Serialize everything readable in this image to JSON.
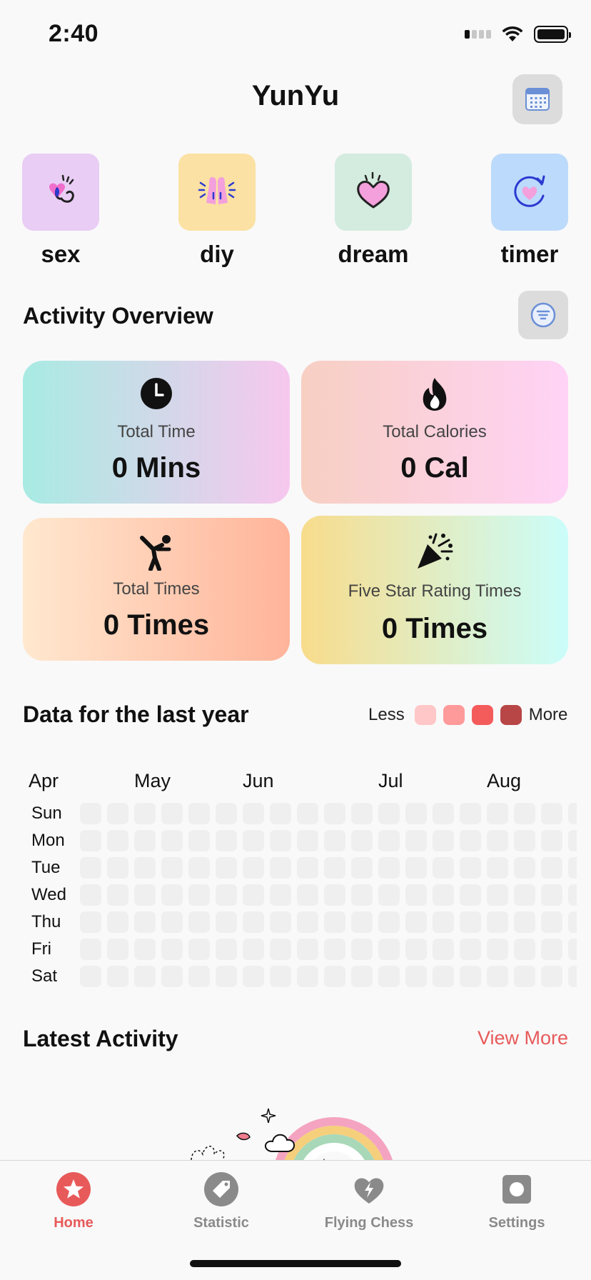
{
  "status_bar": {
    "time": "2:40"
  },
  "header": {
    "title": "YunYu",
    "calendar_icon": "calendar-icon"
  },
  "quick_actions": [
    {
      "label": "sex",
      "icon": "hand-heart-icon",
      "color": "#e9cdf5"
    },
    {
      "label": "diy",
      "icon": "praying-hands-icon",
      "color": "#fbe1a3"
    },
    {
      "label": "dream",
      "icon": "heart-icon",
      "color": "#d4ebdf"
    },
    {
      "label": "timer",
      "icon": "timer-heart-icon",
      "color": "#bcdafb"
    }
  ],
  "overview": {
    "title": "Activity Overview",
    "filter_icon": "filter-icon",
    "cards": [
      {
        "label": "Total Time",
        "value": "0 Mins",
        "icon": "clock-icon"
      },
      {
        "label": "Total Calories",
        "value": "0 Cal",
        "icon": "flame-icon"
      },
      {
        "label": "Total Times",
        "value": "0 Times",
        "icon": "exercise-icon"
      },
      {
        "label": "Five Star Rating Times",
        "value": "0 Times",
        "icon": "party-popper-icon"
      }
    ]
  },
  "heatmap": {
    "title": "Data for the last year",
    "legend_less": "Less",
    "legend_more": "More",
    "legend_colors": [
      "#ffc7c7",
      "#ff9a9a",
      "#f45c5c",
      "#b84646"
    ],
    "months": [
      "Apr",
      "May",
      "Jun",
      "Jul",
      "Aug"
    ],
    "days": [
      "Sun",
      "Mon",
      "Tue",
      "Wed",
      "Thu",
      "Fri",
      "Sat"
    ],
    "empty_color": "#efefef"
  },
  "latest": {
    "title": "Latest Activity",
    "view_more": "View More"
  },
  "tabs": [
    {
      "label": "Home",
      "icon": "star-icon",
      "active": true
    },
    {
      "label": "Statistic",
      "icon": "tag-icon",
      "active": false
    },
    {
      "label": "Flying Chess",
      "icon": "lightning-heart-icon",
      "active": false
    },
    {
      "label": "Settings",
      "icon": "settings-square-icon",
      "active": false
    }
  ],
  "colors": {
    "accent": "#e85a5a",
    "inactive": "#8a8a8a"
  }
}
